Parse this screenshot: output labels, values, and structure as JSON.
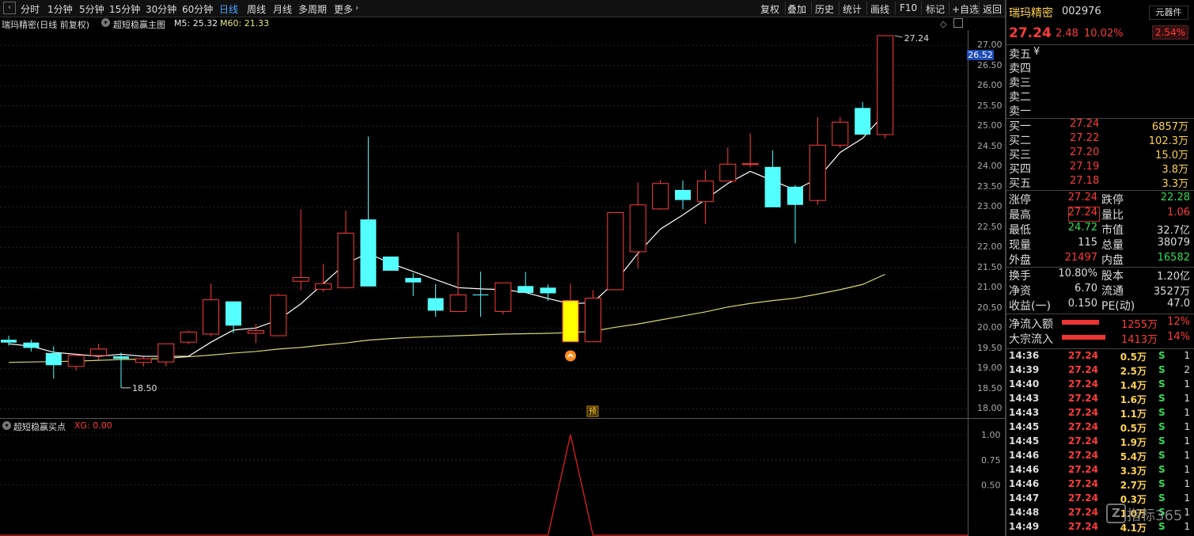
{
  "toolbar": {
    "periods": [
      "分时",
      "1分钟",
      "5分钟",
      "15分钟",
      "30分钟",
      "60分钟",
      "日线",
      "周线",
      "月线",
      "多周期",
      "更多"
    ],
    "active_period": "日线",
    "tools": [
      "复权",
      "叠加",
      "历史",
      "统计",
      "画线",
      "F10",
      "标记",
      "+自选",
      "返回"
    ]
  },
  "chart_header": {
    "stock_info": "瑞玛精密(日线 前复权)",
    "indicator_name": "超短稳赢主图",
    "m5_label": "M5: 25.32",
    "m60_label": "M60: 21.33"
  },
  "chart": {
    "y_ticks": [
      "27.00",
      "26.50",
      "26.00",
      "25.50",
      "25.00",
      "24.50",
      "24.00",
      "23.50",
      "23.00",
      "22.50",
      "22.00",
      "21.50",
      "21.00",
      "20.50",
      "20.00",
      "19.50",
      "19.00",
      "18.50",
      "18.00"
    ],
    "price_tag": "26.52",
    "high_annotation": "27.24",
    "low_annotation": "18.50",
    "marker_label": "预",
    "colors": {
      "up": "#ff3b3b",
      "down": "#54ffff",
      "signal": "#ffff00",
      "ma5": "#ffffff",
      "ma60": "#d8d870"
    }
  },
  "chart_data": {
    "type": "candlestick",
    "ohlc": [
      [
        19.71,
        19.81,
        19.56,
        19.64
      ],
      [
        19.64,
        19.71,
        19.42,
        19.51
      ],
      [
        19.38,
        19.55,
        18.75,
        19.08
      ],
      [
        19.05,
        19.35,
        18.95,
        19.32
      ],
      [
        19.32,
        19.61,
        19.21,
        19.48
      ],
      [
        19.3,
        19.39,
        18.52,
        19.24
      ],
      [
        19.15,
        19.29,
        19.05,
        19.24
      ],
      [
        19.16,
        19.58,
        19.05,
        19.61
      ],
      [
        19.65,
        19.94,
        19.6,
        19.9
      ],
      [
        19.85,
        21.1,
        19.8,
        20.7
      ],
      [
        20.66,
        20.62,
        19.87,
        20.06
      ],
      [
        19.87,
        20.1,
        19.63,
        19.94
      ],
      [
        19.81,
        20.85,
        19.81,
        20.81
      ],
      [
        21.16,
        22.94,
        20.94,
        21.25
      ],
      [
        20.96,
        21.59,
        20.9,
        21.1
      ],
      [
        21.0,
        22.91,
        20.98,
        22.35
      ],
      [
        22.69,
        24.74,
        22.02,
        21.03
      ],
      [
        21.77,
        21.76,
        21.53,
        21.42
      ],
      [
        21.24,
        21.36,
        20.79,
        21.13
      ],
      [
        20.74,
        21.09,
        20.28,
        20.43
      ],
      [
        20.41,
        22.37,
        20.42,
        20.82
      ],
      [
        20.83,
        21.4,
        20.28,
        20.81
      ],
      [
        20.41,
        21.09,
        20.34,
        21.12
      ],
      [
        21.04,
        21.39,
        20.95,
        20.87
      ],
      [
        21.0,
        21.08,
        20.67,
        20.86
      ],
      [
        20.68,
        21.1,
        19.86,
        19.66
      ],
      [
        19.66,
        20.94,
        19.65,
        20.74
      ],
      [
        20.95,
        22.68,
        20.98,
        22.86
      ],
      [
        21.89,
        23.6,
        21.47,
        23.05
      ],
      [
        22.95,
        23.67,
        22.93,
        23.58
      ],
      [
        23.42,
        23.65,
        22.94,
        23.17
      ],
      [
        23.13,
        23.91,
        22.57,
        23.64
      ],
      [
        23.64,
        24.47,
        23.78,
        24.06
      ],
      [
        24.05,
        24.82,
        23.98,
        24.07
      ],
      [
        23.99,
        24.4,
        23.91,
        22.99
      ],
      [
        23.5,
        23.54,
        22.1,
        23.05
      ],
      [
        23.16,
        25.22,
        23.05,
        24.53
      ],
      [
        24.53,
        25.23,
        24.46,
        25.1
      ],
      [
        25.45,
        25.6,
        25.42,
        24.79
      ],
      [
        24.79,
        27.24,
        24.7,
        27.24
      ]
    ],
    "ma5": [
      19.61,
      19.55,
      19.4,
      19.35,
      19.3,
      19.35,
      19.3,
      19.3,
      19.3,
      19.65,
      19.95,
      20.0,
      20.2,
      20.6,
      21.1,
      21.6,
      21.85,
      21.6,
      21.4,
      21.2,
      21.0,
      20.97,
      20.95,
      20.88,
      20.73,
      20.6,
      20.63,
      21.15,
      21.85,
      22.45,
      22.8,
      23.18,
      23.58,
      23.88,
      23.65,
      23.42,
      23.7,
      24.35,
      24.7,
      25.32
    ],
    "ma60": [
      19.15,
      19.16,
      19.17,
      19.18,
      19.2,
      19.22,
      19.23,
      19.25,
      19.29,
      19.33,
      19.38,
      19.42,
      19.48,
      19.52,
      19.58,
      19.63,
      19.7,
      19.74,
      19.77,
      19.79,
      19.81,
      19.83,
      19.85,
      19.86,
      19.87,
      19.89,
      19.92,
      20.02,
      20.1,
      20.2,
      20.3,
      20.4,
      20.52,
      20.61,
      20.68,
      20.74,
      20.84,
      20.95,
      21.08,
      21.33
    ],
    "signal_bar_index": 25,
    "ylim": [
      17.85,
      27.3
    ]
  },
  "sub_chart": {
    "indicator_name": "超短稳赢买点",
    "xg_label": "XG: 0.00",
    "y_ticks": [
      "1.00",
      "0.75",
      "0.50"
    ],
    "values": [
      0,
      0,
      0,
      0,
      0,
      0,
      0,
      0,
      0,
      0,
      0,
      0,
      0,
      0,
      0,
      0,
      0,
      0,
      0,
      0,
      0,
      0,
      0,
      0,
      0,
      1,
      0,
      0,
      0,
      0,
      0,
      0,
      0,
      0,
      0,
      0,
      0,
      0,
      0,
      0
    ],
    "ylim": [
      0,
      1
    ]
  },
  "quote": {
    "name": "瑞玛精密",
    "code": "002976",
    "component_btn": "元器件",
    "price": "27.24",
    "change": "2.48",
    "pct": "10.02%",
    "sector_pct": "2.54%",
    "sells": [
      {
        "label": "卖五",
        "price": "",
        "vol": ""
      },
      {
        "label": "卖四",
        "price": "",
        "vol": ""
      },
      {
        "label": "卖三",
        "price": "",
        "vol": ""
      },
      {
        "label": "卖二",
        "price": "",
        "vol": ""
      },
      {
        "label": "卖一",
        "price": "",
        "vol": ""
      }
    ],
    "sell_currency": "¥",
    "buys": [
      {
        "label": "买一",
        "price": "27.24",
        "vol": "6857万"
      },
      {
        "label": "买二",
        "price": "27.22",
        "vol": "102.3万"
      },
      {
        "label": "买三",
        "price": "27.20",
        "vol": "15.0万"
      },
      {
        "label": "买四",
        "price": "27.19",
        "vol": "3.8万"
      },
      {
        "label": "买五",
        "price": "27.18",
        "vol": "3.3万"
      }
    ],
    "stats": [
      {
        "l1": "涨停",
        "v1": "27.24",
        "c1": "#ff3b3b",
        "l2": "跌停",
        "v2": "22.28",
        "c2": "#33dd55"
      },
      {
        "l1": "最高",
        "v1": "27.24",
        "c1": "#ff3b3b",
        "l2": "量比",
        "v2": "1.06",
        "c2": "#ff3b3b"
      },
      {
        "l1": "最低",
        "v1": "24.72",
        "c1": "#33dd55",
        "l2": "市值",
        "v2": "32.7亿",
        "c2": "#dddddd"
      },
      {
        "l1": "现量",
        "v1": "115",
        "c1": "#dddddd",
        "l2": "总量",
        "v2": "38079",
        "c2": "#dddddd"
      },
      {
        "l1": "外盘",
        "v1": "21497",
        "c1": "#ff3b3b",
        "l2": "内盘",
        "v2": "16582",
        "c2": "#33dd55"
      }
    ],
    "finance": [
      {
        "l1": "换手",
        "v1": "10.80%",
        "l2": "股本",
        "v2": "1.20亿"
      },
      {
        "l1": "净资",
        "v1": "6.70",
        "l2": "流通",
        "v2": "3527万"
      },
      {
        "l1": "收益(一)",
        "v1": "0.150",
        "l2": "PE(动)",
        "v2": "47.0"
      }
    ],
    "flows": [
      {
        "label": "净流入额",
        "value": "1255万",
        "pct": "12%",
        "bar": 0.12
      },
      {
        "label": "大宗流入",
        "value": "1413万",
        "pct": "14%",
        "bar": 0.14
      }
    ],
    "ticks": [
      {
        "time": "14:36",
        "price": "27.24",
        "vol": "0.5万",
        "side": "S",
        "n": "1"
      },
      {
        "time": "14:39",
        "price": "27.24",
        "vol": "2.5万",
        "side": "S",
        "n": "2"
      },
      {
        "time": "14:40",
        "price": "27.24",
        "vol": "1.4万",
        "side": "S",
        "n": "1"
      },
      {
        "time": "14:43",
        "price": "27.24",
        "vol": "1.6万",
        "side": "S",
        "n": "1"
      },
      {
        "time": "14:43",
        "price": "27.24",
        "vol": "1.1万",
        "side": "S",
        "n": "1"
      },
      {
        "time": "14:45",
        "price": "27.24",
        "vol": "0.5万",
        "side": "S",
        "n": "1"
      },
      {
        "time": "14:45",
        "price": "27.24",
        "vol": "1.9万",
        "side": "S",
        "n": "1"
      },
      {
        "time": "14:46",
        "price": "27.24",
        "vol": "5.4万",
        "side": "S",
        "n": "1"
      },
      {
        "time": "14:46",
        "price": "27.24",
        "vol": "3.3万",
        "side": "S",
        "n": "1"
      },
      {
        "time": "14:46",
        "price": "27.24",
        "vol": "2.7万",
        "side": "S",
        "n": "1"
      },
      {
        "time": "14:47",
        "price": "27.24",
        "vol": "0.3万",
        "side": "S",
        "n": "1"
      },
      {
        "time": "14:48",
        "price": "27.24",
        "vol": "1.0万",
        "side": "S",
        "n": "1"
      },
      {
        "time": "14:49",
        "price": "27.24",
        "vol": "4.1万",
        "side": "S",
        "n": "1"
      }
    ],
    "watermark": "指标365"
  }
}
